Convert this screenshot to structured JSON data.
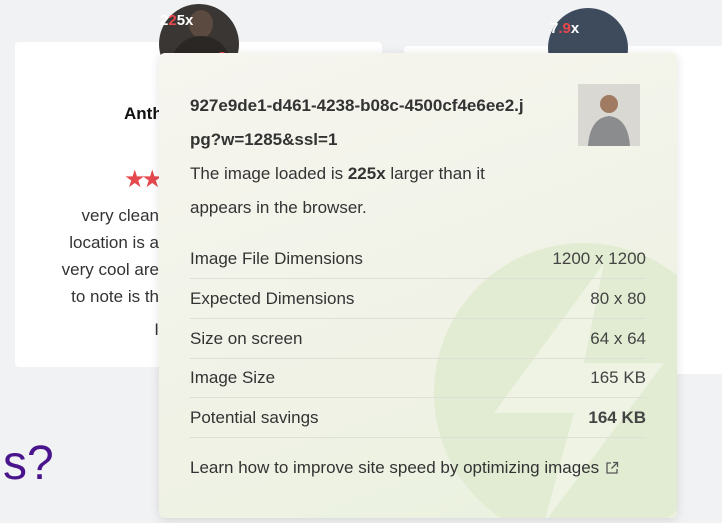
{
  "left_card": {
    "reviewer_name": "Anth",
    "stars": "★★",
    "review_lines": [
      "very clean",
      "location is a",
      "very cool are",
      "to note is th",
      "I"
    ],
    "badge": {
      "prefix": "2",
      "accent": "2",
      "suffix": "5x"
    }
  },
  "right_card": {
    "badge": {
      "prefix": "7",
      "accent": ".9",
      "suffix": "x"
    }
  },
  "page_text": {
    "big_s": "s?"
  },
  "popup": {
    "filename": "927e9de1-d461-4238-b08c-4500cf4e6ee2.jpg?w=1285&ssl=1",
    "description_prefix": "The image loaded is ",
    "description_ratio": "225x",
    "description_suffix": " larger than it appears in the browser.",
    "rows": [
      {
        "label": "Image File Dimensions",
        "value": "1200 x 1200"
      },
      {
        "label": "Expected Dimensions",
        "value": "80 x 80"
      },
      {
        "label": "Size on screen",
        "value": "64 x 64"
      },
      {
        "label": "Image Size",
        "value": "165 KB"
      },
      {
        "label": "Potential savings",
        "value": "164 KB"
      }
    ],
    "learn_more": "Learn how to improve site speed by optimizing images",
    "learn_more_icon": "external-link-icon"
  },
  "colors": {
    "accent_red": "#e5484d",
    "purple": "#4a148c",
    "popup_green": "#e9f1dd"
  }
}
